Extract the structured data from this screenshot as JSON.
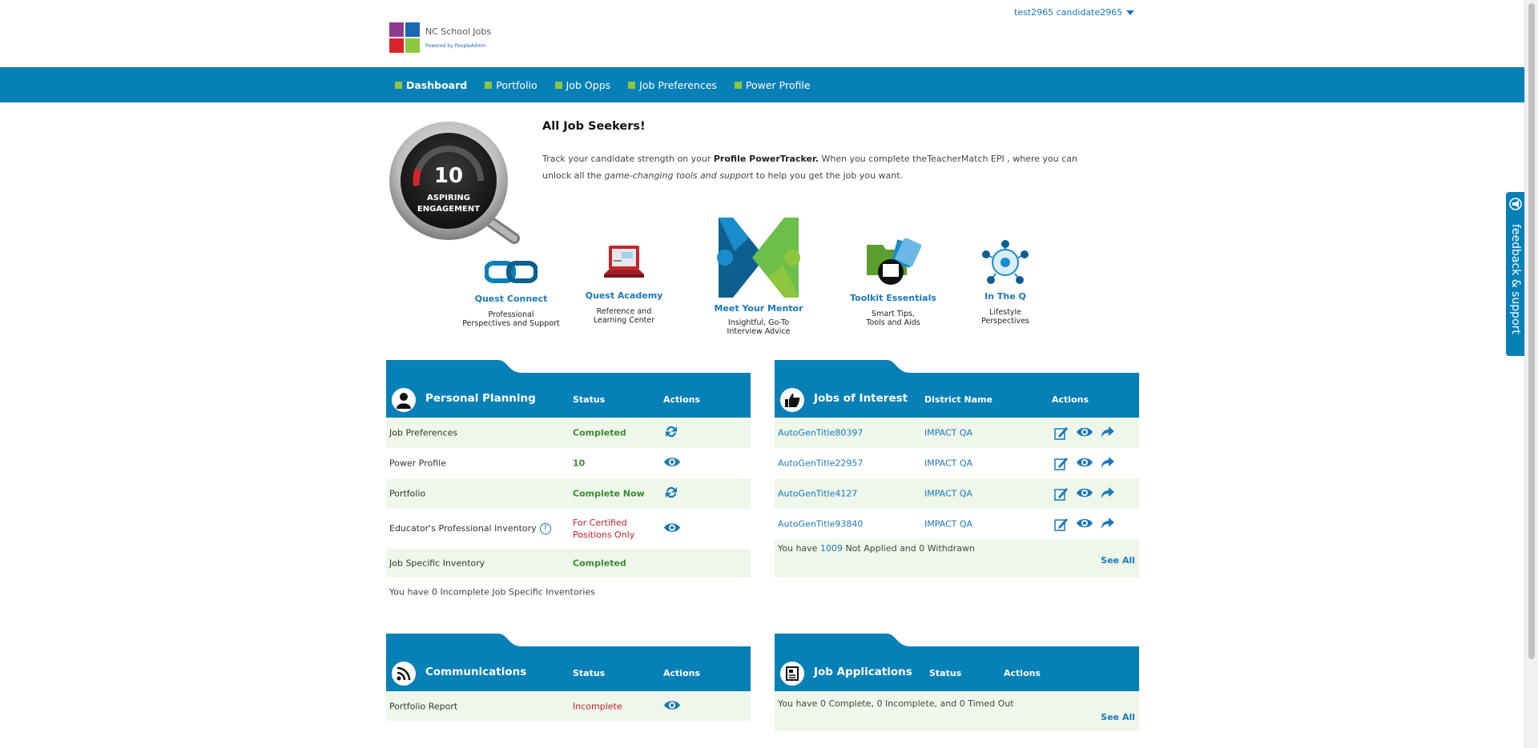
{
  "header": {
    "logo_name": "NC School Jobs",
    "logo_sub": "Powered by PeopleAdmin",
    "user": "test2965 candidate2965"
  },
  "nav": {
    "items": [
      {
        "label": "Dashboard",
        "active": true
      },
      {
        "label": "Portfolio"
      },
      {
        "label": "Job Opps"
      },
      {
        "label": "Job Preferences"
      },
      {
        "label": "Power Profile"
      }
    ]
  },
  "gauge": {
    "score": "10",
    "line1": "ASPIRING",
    "line2": "ENGAGEMENT"
  },
  "intro": {
    "title": "All Job Seekers!",
    "text_1": "Track your candidate strength on your ",
    "text_bold": "Profile PowerTracker.",
    "text_2": " When you complete theTeacherMatch EPI , where you can unlock all the ",
    "text_italic": "game-changing tools and support",
    "text_3": " to help you get the job you want."
  },
  "tiles": [
    {
      "label": "Quest Connect",
      "desc_1": "Professional",
      "desc_2": "Perspectives and Support",
      "icon": "chain-link-icon"
    },
    {
      "label": "Quest Academy",
      "desc_1": "Reference and",
      "desc_2": "Learning Center",
      "icon": "laptop-icon"
    },
    {
      "label": "Meet Your Mentor",
      "desc_1": "Insightful, Go-To",
      "desc_2": "Interview Advice",
      "icon": "mentor-arrows-icon"
    },
    {
      "label": "Toolkit Essentials",
      "desc_1": "Smart Tips,",
      "desc_2": "Tools and Aids",
      "icon": "toolkit-folder-icon"
    },
    {
      "label": "In The Q",
      "desc_1": "Lifestyle",
      "desc_2": "Perspectives",
      "icon": "network-icon"
    }
  ],
  "personal_planning": {
    "title": "Personal Planning",
    "col_status": "Status",
    "col_actions": "Actions",
    "rows": [
      {
        "name": "Job Preferences",
        "status": "Completed",
        "action_icon": "refresh-icon"
      },
      {
        "name": "Power Profile",
        "status": "10",
        "action_icon": "eye-icon"
      },
      {
        "name": "Portfolio",
        "status": "Complete Now",
        "action_icon": "refresh-icon"
      },
      {
        "name": "Educator's Professional Inventory",
        "help": "?",
        "status_1": "For Certified",
        "status_2": "Positions Only",
        "action_icon": "eye-icon"
      },
      {
        "name": "Job Specific Inventory",
        "status": "Completed"
      }
    ],
    "note": "You have 0 Incomplete Job Specific Inventories"
  },
  "jobs_of_interest": {
    "title": "Jobs of Interest",
    "col_district": "District Name",
    "col_actions": "Actions",
    "rows": [
      {
        "title": "AutoGenTitle80397",
        "district": "IMPACT QA"
      },
      {
        "title": "AutoGenTitle22957",
        "district": "IMPACT QA"
      },
      {
        "title": "AutoGenTitle4127",
        "district": "IMPACT QA"
      },
      {
        "title": "AutoGenTitle93840",
        "district": "IMPACT QA"
      }
    ],
    "note_1": "You have ",
    "note_count": "1009",
    "note_2": " Not Applied and 0 Withdrawn",
    "see_all": "See All"
  },
  "communications": {
    "title": "Communications",
    "col_status": "Status",
    "col_actions": "Actions",
    "rows": [
      {
        "name": "Portfolio Report",
        "status": "Incomplete",
        "action_icon": "eye-icon"
      }
    ]
  },
  "job_applications": {
    "title": "Job Applications",
    "col_status": "Status",
    "col_actions": "Actions",
    "note": "You have 0 Complete, 0 Incomplete, and 0 Timed Out",
    "see_all": "See All"
  },
  "feedback": {
    "label": "feedback & support"
  },
  "colors": {
    "primary": "#0780b8",
    "accent_green": "#8dc63f",
    "status_green": "#3c8a32",
    "status_red": "#c0202a",
    "row_alt": "#eef7ea"
  }
}
